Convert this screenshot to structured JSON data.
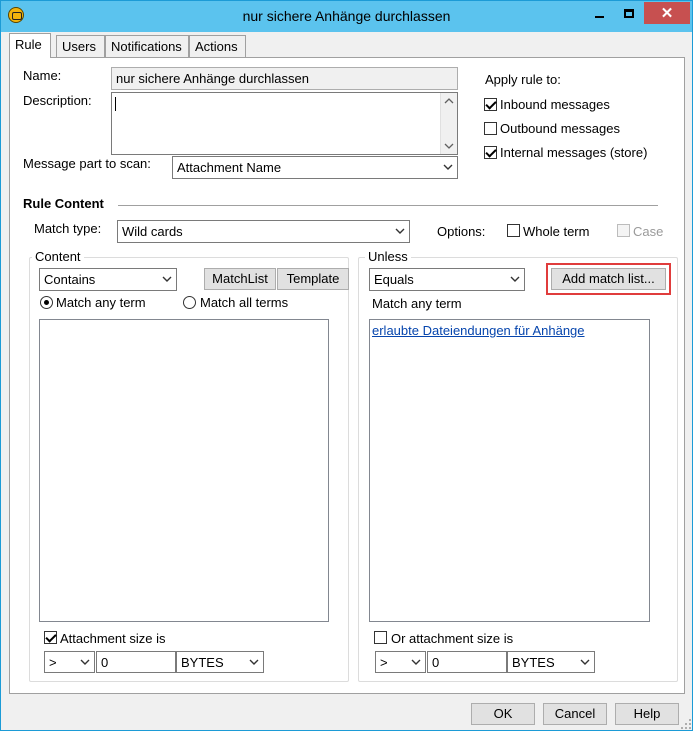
{
  "window": {
    "title": "nur sichere Anhänge durchlassen"
  },
  "tabs": [
    {
      "label": "Rule"
    },
    {
      "label": "Users"
    },
    {
      "label": "Notifications"
    },
    {
      "label": "Actions"
    }
  ],
  "form": {
    "name_label": "Name:",
    "name_value": "nur sichere Anhänge durchlassen",
    "description_label": "Description:",
    "description_value": "",
    "message_part_label": "Message part to scan:",
    "message_part_value": "Attachment Name"
  },
  "apply": {
    "title": "Apply rule to:",
    "inbound": {
      "label": "Inbound messages",
      "checked": true
    },
    "outbound": {
      "label": "Outbound messages",
      "checked": false
    },
    "internal": {
      "label": "Internal messages (store)",
      "checked": true
    }
  },
  "rule_content": {
    "heading": "Rule Content",
    "match_type_label": "Match type:",
    "match_type_value": "Wild cards",
    "options_label": "Options:",
    "whole_term_label": "Whole term",
    "case_label": "Case"
  },
  "content": {
    "group_label": "Content",
    "operator": "Contains",
    "matchlist_button": "MatchList",
    "template_button": "Template",
    "match_any_label": "Match any term",
    "match_all_label": "Match all terms",
    "terms": [],
    "size_check_label": "Attachment size is",
    "size_check_checked": true,
    "size_op": ">",
    "size_value": "0",
    "size_unit": "BYTES"
  },
  "unless": {
    "group_label": "Unless",
    "operator": "Equals",
    "add_match_list_button": "Add match list...",
    "match_any_label": "Match any term",
    "terms": [
      "erlaubte Dateiendungen für Anhänge"
    ],
    "size_check_label": "Or attachment size is",
    "size_check_checked": false,
    "size_op": ">",
    "size_value": "0",
    "size_unit": "BYTES"
  },
  "footer": {
    "ok": "OK",
    "cancel": "Cancel",
    "help": "Help"
  },
  "colors": {
    "titlebar": "#5bc3ee",
    "close_button": "#c75050",
    "highlight_border": "#e03c3c",
    "link": "#0645ad"
  }
}
